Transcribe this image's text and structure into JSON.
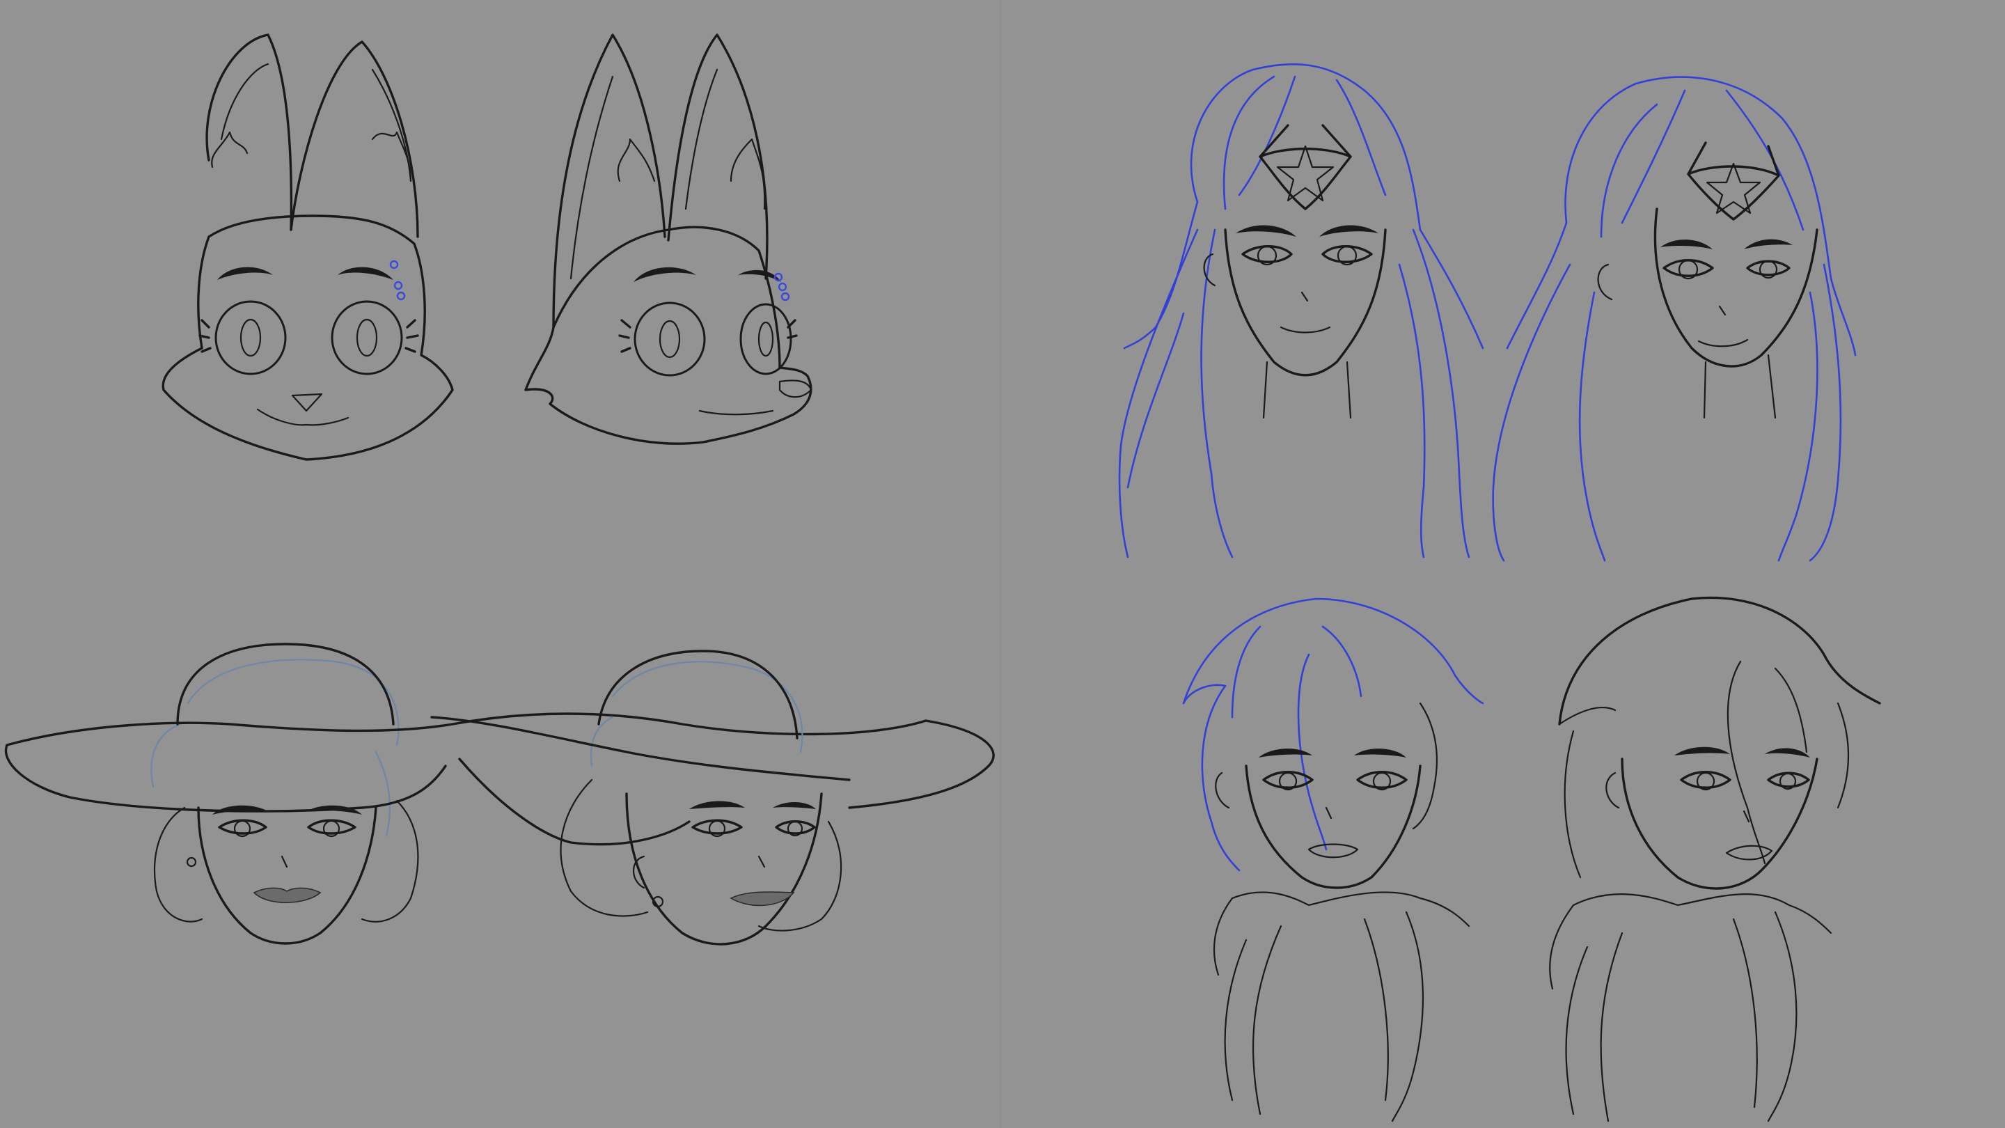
{
  "canvas": {
    "background": "#939393",
    "divider_color": "#8d8d8d",
    "ink_color": "#1a1a1a",
    "sketch_color_blue": "#3240d8",
    "sketch_color_pale": "#6f86a6"
  },
  "drawings": [
    {
      "name": "fox-head-front",
      "style": "line-art"
    },
    {
      "name": "fox-head-three-quarter",
      "style": "line-art"
    },
    {
      "name": "woman-long-hair-tiara-front",
      "style": "blue-sketch-with-ink"
    },
    {
      "name": "woman-long-hair-tiara-three-quarter",
      "style": "blue-sketch-with-ink"
    },
    {
      "name": "woman-sun-hat-front",
      "style": "ink-with-grey-tone"
    },
    {
      "name": "woman-sun-hat-three-quarter",
      "style": "ink-with-grey-tone"
    },
    {
      "name": "short-hair-character-front",
      "style": "blue-sketch-with-ink"
    },
    {
      "name": "short-hair-character-three-quarter",
      "style": "line-art"
    }
  ]
}
